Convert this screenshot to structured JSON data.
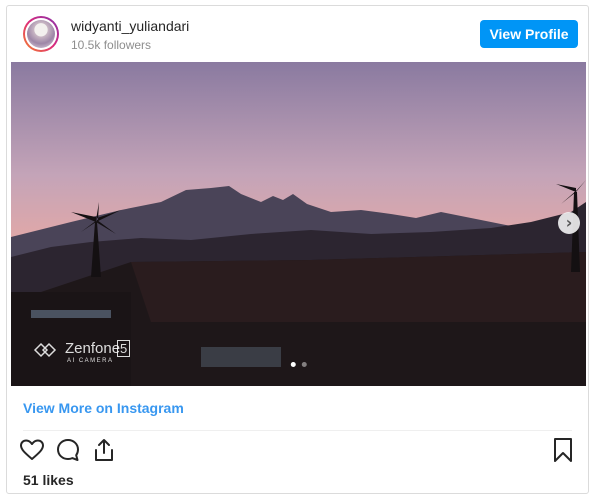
{
  "header": {
    "username": "widyanti_yuliandari",
    "followers": "10.5k followers",
    "view_profile_label": "View Profile"
  },
  "media": {
    "watermark_brand": "Zenfone",
    "watermark_model": "5",
    "watermark_sub": "AI CAMERA",
    "carousel_total": 2,
    "carousel_active": 1
  },
  "links": {
    "view_more": "View More on Instagram"
  },
  "actions": {
    "icons": [
      "heart-icon",
      "comment-icon",
      "share-icon",
      "bookmark-icon"
    ]
  },
  "stats": {
    "likes": "51 likes"
  },
  "colors": {
    "primary_button": "#0095f6",
    "link": "#3897f0",
    "border": "#dbdbdb"
  }
}
